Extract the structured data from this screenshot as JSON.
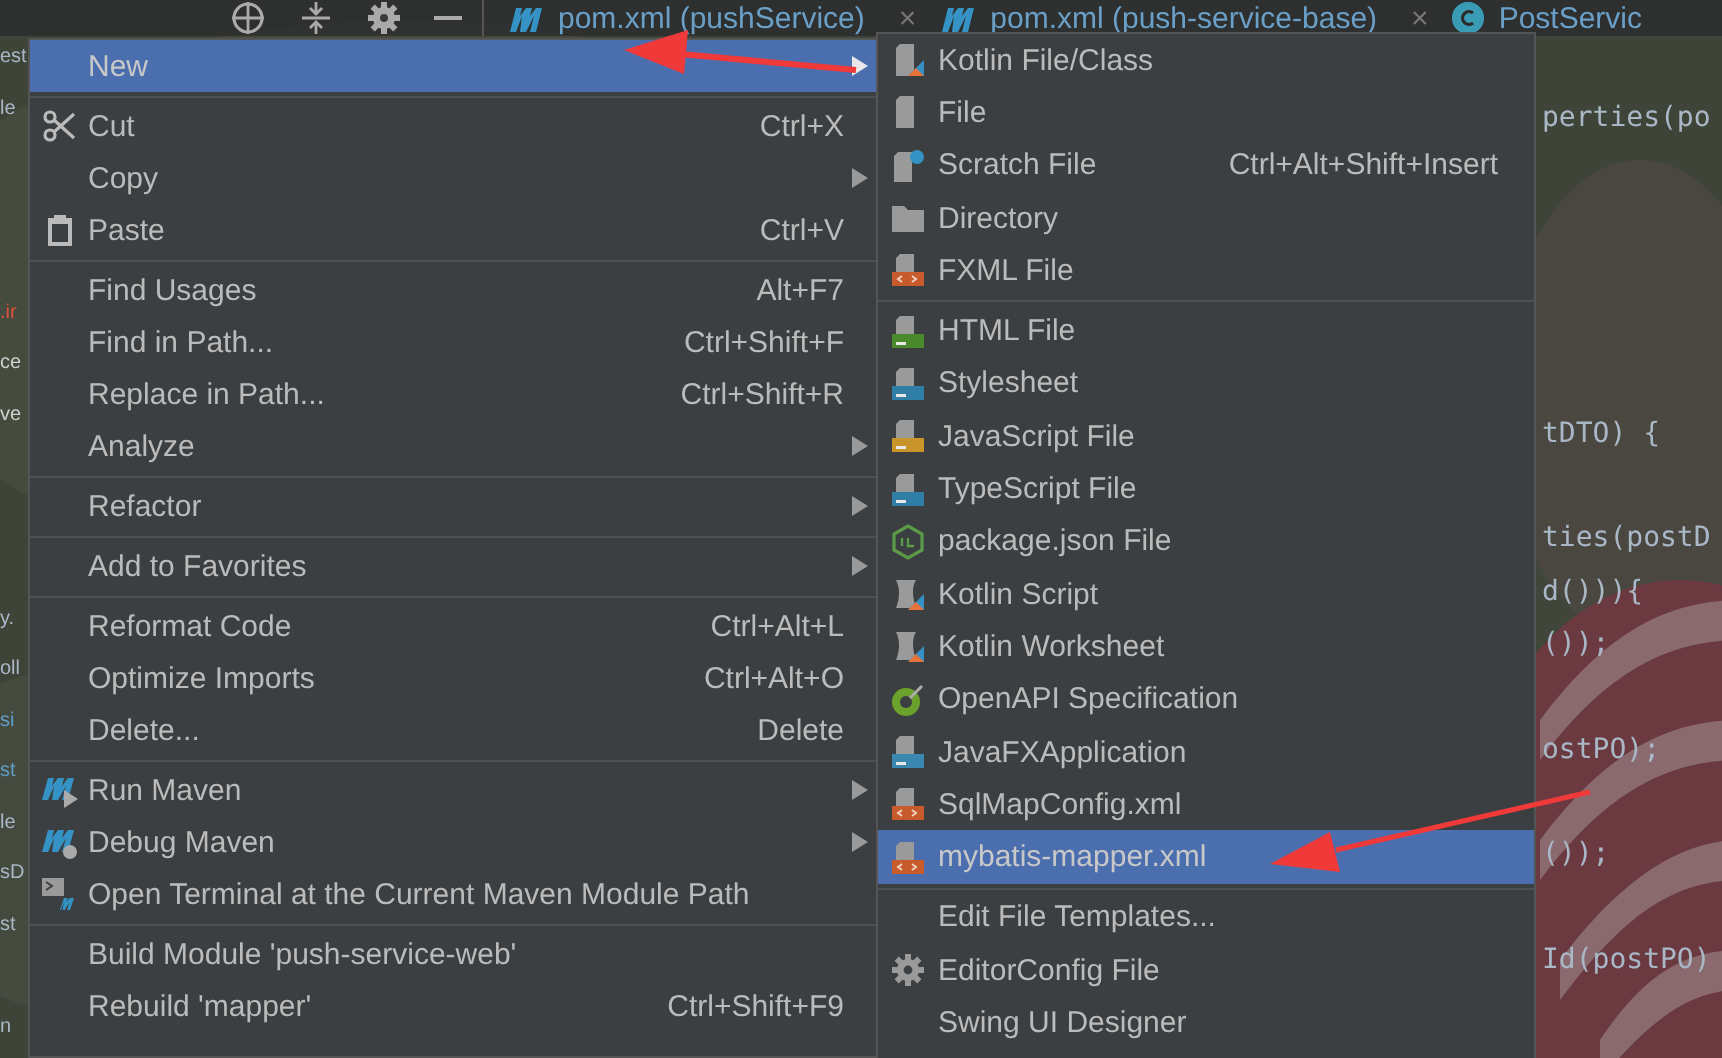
{
  "toolbar": {
    "tabs": [
      {
        "label": "pom.xml (pushService)",
        "kind": "maven",
        "close": "×"
      },
      {
        "label": "pom.xml (push-service-base)",
        "kind": "maven",
        "close": "×"
      },
      {
        "label": "PostServic",
        "kind": "class"
      }
    ]
  },
  "gutter": [
    {
      "text": "est",
      "color": "#a9b7c6"
    },
    {
      "text": "le",
      "color": "#a9b7c6"
    },
    {
      "text": ".ir",
      "color": "#e0503c"
    },
    {
      "text": "ce",
      "color": "#d0d0d0"
    },
    {
      "text": "ve",
      "color": "#d0d0d0"
    },
    {
      "text": "y.",
      "color": "#a9b7c6"
    },
    {
      "text": "oll",
      "color": "#a9b7c6"
    },
    {
      "text": "si",
      "color": "#5f9ec8"
    },
    {
      "text": "st",
      "color": "#5f9ec8"
    },
    {
      "text": "le",
      "color": "#a9b7c6"
    },
    {
      "text": "sD",
      "color": "#a9b7c6"
    },
    {
      "text": "st",
      "color": "#a9b7c6"
    },
    {
      "text": "n",
      "color": "#a9b7c6"
    }
  ],
  "code": [
    "perties(po",
    "tDTO) {",
    "ties(postD",
    "d())){",
    "());",
    "ostPO);",
    "());",
    "Id(postPO)"
  ],
  "context_menu": {
    "groups": [
      [
        {
          "label": "New",
          "submenu": true,
          "selected": true
        }
      ],
      [
        {
          "label": "Cut",
          "kind": "cut",
          "shortcut": "Ctrl+X",
          "submenu": false,
          "selected": false
        },
        {
          "label": "Copy",
          "submenu": true,
          "selected": false
        },
        {
          "label": "Paste",
          "kind": "paste",
          "shortcut": "Ctrl+V",
          "submenu": false,
          "selected": false
        }
      ],
      [
        {
          "label": "Find Usages",
          "shortcut": "Alt+F7",
          "submenu": false,
          "selected": false
        },
        {
          "label": "Find in Path...",
          "shortcut": "Ctrl+Shift+F",
          "submenu": false,
          "selected": false
        },
        {
          "label": "Replace in Path...",
          "shortcut": "Ctrl+Shift+R",
          "submenu": false,
          "selected": false
        },
        {
          "label": "Analyze",
          "submenu": true,
          "selected": false
        }
      ],
      [
        {
          "label": "Refactor",
          "submenu": true,
          "selected": false
        }
      ],
      [
        {
          "label": "Add to Favorites",
          "submenu": true,
          "selected": false
        }
      ],
      [
        {
          "label": "Reformat Code",
          "shortcut": "Ctrl+Alt+L",
          "submenu": false,
          "selected": false
        },
        {
          "label": "Optimize Imports",
          "shortcut": "Ctrl+Alt+O",
          "submenu": false,
          "selected": false
        },
        {
          "label": "Delete...",
          "shortcut": "Delete",
          "submenu": false,
          "selected": false
        }
      ],
      [
        {
          "label": "Run Maven",
          "kind": "maven-run",
          "submenu": true,
          "selected": false
        },
        {
          "label": "Debug Maven",
          "kind": "maven-debug",
          "submenu": true,
          "selected": false
        },
        {
          "label": "Open Terminal at the Current Maven Module Path",
          "kind": "terminal",
          "submenu": false,
          "selected": false
        }
      ],
      [
        {
          "label": "Build Module 'push-service-web'",
          "submenu": false,
          "selected": false
        },
        {
          "label": "Rebuild 'mapper'",
          "shortcut": "Ctrl+Shift+F9",
          "submenu": false,
          "selected": false
        }
      ]
    ]
  },
  "new_submenu": {
    "groups": [
      [
        {
          "label": "Kotlin File/Class",
          "kind": "kotlin",
          "selected": false
        },
        {
          "label": "File",
          "kind": "file",
          "selected": false
        },
        {
          "label": "Scratch File",
          "kind": "scratch",
          "shortcut": "Ctrl+Alt+Shift+Insert",
          "selected": false
        },
        {
          "label": "Directory",
          "kind": "folder",
          "selected": false
        },
        {
          "label": "FXML File",
          "kind": "xml",
          "selected": false
        }
      ],
      [
        {
          "label": "HTML File",
          "kind": "html",
          "selected": false
        },
        {
          "label": "Stylesheet",
          "kind": "css",
          "selected": false
        },
        {
          "label": "JavaScript File",
          "kind": "js",
          "selected": false
        },
        {
          "label": "TypeScript File",
          "kind": "ts",
          "selected": false
        },
        {
          "label": "package.json File",
          "kind": "node",
          "selected": false
        },
        {
          "label": "Kotlin Script",
          "kind": "kotlin-script",
          "selected": false
        },
        {
          "label": "Kotlin Worksheet",
          "kind": "kotlin-script",
          "selected": false
        },
        {
          "label": "OpenAPI Specification",
          "kind": "openapi",
          "selected": false
        },
        {
          "label": "JavaFXApplication",
          "kind": "javafx",
          "selected": false
        },
        {
          "label": "SqlMapConfig.xml",
          "kind": "xml",
          "selected": false
        },
        {
          "label": "mybatis-mapper.xml",
          "kind": "xml",
          "selected": true
        }
      ],
      [
        {
          "label": "Edit File Templates...",
          "selected": false
        },
        {
          "label": "EditorConfig File",
          "kind": "gear",
          "selected": false
        },
        {
          "label": "Swing UI Designer",
          "selected": false
        }
      ]
    ]
  }
}
